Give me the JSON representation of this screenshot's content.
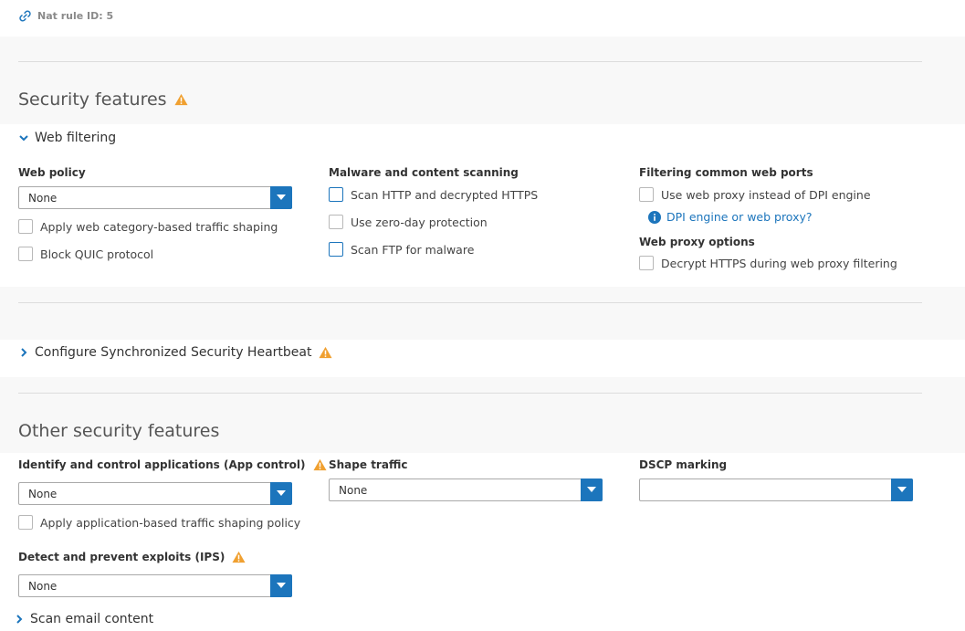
{
  "nat_rule": {
    "label": "Nat rule ID: 5"
  },
  "security_features": {
    "title": "Security features",
    "web_filtering": {
      "toggle_label": "Web filtering",
      "web_policy": {
        "label": "Web policy",
        "value": "None",
        "checkboxes": [
          {
            "label": "Apply web category-based traffic shaping",
            "checked": false
          },
          {
            "label": "Block QUIC protocol",
            "checked": false
          }
        ]
      },
      "malware_scanning": {
        "label": "Malware and content scanning",
        "checkboxes": [
          {
            "label": "Scan HTTP and decrypted HTTPS",
            "checked": false
          },
          {
            "label": "Use zero-day protection",
            "checked": false
          },
          {
            "label": "Scan FTP for malware",
            "checked": false
          }
        ]
      },
      "filtering_ports": {
        "label": "Filtering common web ports",
        "checkbox": {
          "label": "Use web proxy instead of DPI engine",
          "checked": false
        },
        "info_link": "DPI engine or web proxy?"
      },
      "web_proxy_options": {
        "label": "Web proxy options",
        "checkbox": {
          "label": "Decrypt HTTPS during web proxy filtering",
          "checked": false
        }
      }
    }
  },
  "heartbeat": {
    "toggle_label": "Configure Synchronized Security Heartbeat"
  },
  "other_security": {
    "title": "Other security features",
    "app_control": {
      "label": "Identify and control applications (App control)",
      "value": "None",
      "checkbox": {
        "label": "Apply application-based traffic shaping policy",
        "checked": false
      }
    },
    "shape_traffic": {
      "label": "Shape traffic",
      "value": "None"
    },
    "dscp_marking": {
      "label": "DSCP marking",
      "value": ""
    },
    "ips": {
      "label": "Detect and prevent exploits (IPS)",
      "value": "None"
    },
    "scan_email": {
      "toggle_label": "Scan email content"
    }
  },
  "colors": {
    "accent": "#1c75bc",
    "warning": "#f0a030",
    "band_background": "#f8f8f8"
  }
}
